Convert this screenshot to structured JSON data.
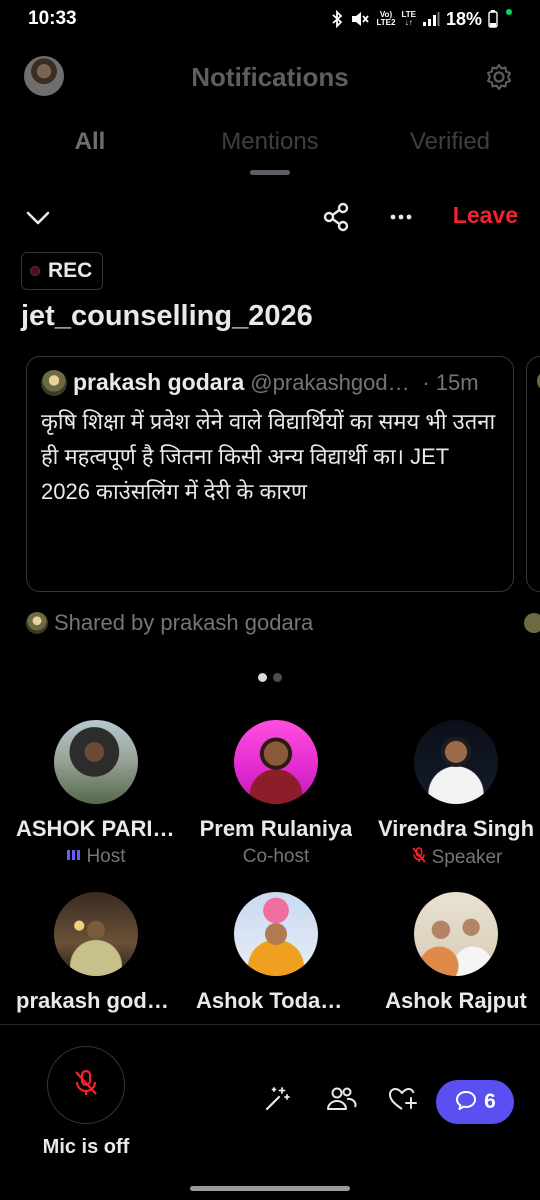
{
  "status_bar": {
    "time": "10:33",
    "network_top": "Vo)",
    "network_bottom": "LTE2",
    "lte_top": "LTE",
    "lte_bottom": "↓↑",
    "battery": "18%"
  },
  "notifications": {
    "title": "Notifications",
    "tabs": [
      "All",
      "Mentions",
      "Verified"
    ]
  },
  "space": {
    "leave_label": "Leave",
    "rec_label": "REC",
    "title": "jet_counselling_2026",
    "shared_by": "Shared by prakash godara",
    "pager": {
      "total": 2,
      "active": 1
    }
  },
  "tweet": {
    "name": "prakash godara",
    "handle": "@prakashgodara",
    "time": "· 15m",
    "text": "कृषि शिक्षा में प्रवेश लेने वाले विद्यार्थियों का समय भी उतना ही महत्वपूर्ण है जितना किसी अन्य विद्यार्थी का। JET 2026 काउंसलिंग में देरी के कारण"
  },
  "participants": [
    {
      "name": "ASHOK PARIHAR",
      "role": "Host",
      "role_icon": "host-audio-icon"
    },
    {
      "name": "Prem Rulaniya",
      "role": "Co-host",
      "role_icon": ""
    },
    {
      "name": "Virendra Singh",
      "role": "Speaker",
      "role_icon": "mic-muted-icon"
    },
    {
      "name": "prakash godara",
      "role": "",
      "role_icon": ""
    },
    {
      "name": "Ashok Todawat",
      "role": "",
      "role_icon": ""
    },
    {
      "name": "Ashok Rajput",
      "role": "",
      "role_icon": ""
    }
  ],
  "controls": {
    "mic_label": "Mic is off",
    "chat_count": "6"
  },
  "colors": {
    "leave": "#f4212e",
    "chat_pill": "#5a4ff0",
    "host_icon": "#6b5cff",
    "muted_icon": "#f4212e"
  }
}
